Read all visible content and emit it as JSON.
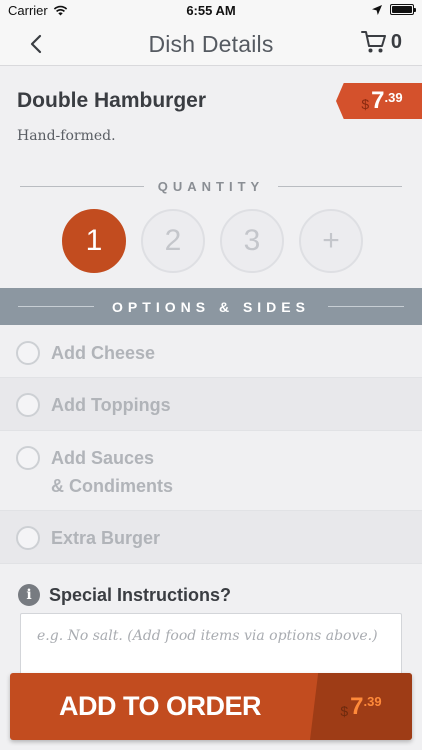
{
  "status_bar": {
    "carrier": "Carrier",
    "time": "6:55 AM",
    "icons": [
      "wifi-icon",
      "location-arrow-icon",
      "battery-icon"
    ]
  },
  "nav": {
    "title": "Dish Details",
    "cart_count": "0",
    "icons": [
      "chevron-left-icon",
      "cart-icon"
    ]
  },
  "dish": {
    "name": "Double Hamburger",
    "description": "Hand-formed.",
    "price": {
      "currency": "$",
      "whole": "7",
      "cents": ".39"
    }
  },
  "quantity": {
    "label": "QUANTITY",
    "options": [
      "1",
      "2",
      "3",
      "+"
    ],
    "selected": "1"
  },
  "options_section": {
    "label": "OPTIONS & SIDES",
    "items": [
      {
        "label": "Add Cheese",
        "label2": ""
      },
      {
        "label": "Add Toppings",
        "label2": ""
      },
      {
        "label": "Add Sauces",
        "label2": "& Condiments"
      },
      {
        "label": "Extra Burger",
        "label2": ""
      }
    ]
  },
  "instructions": {
    "title": "Special Instructions?",
    "placeholder": "e.g. No salt. (Add food items via options above.)"
  },
  "add_button": {
    "label": "ADD TO ORDER",
    "price": {
      "currency": "$",
      "whole": "7",
      "cents": ".39"
    }
  },
  "colors": {
    "accent": "#c24c1f",
    "price_tag": "#d4512c",
    "section_bar": "#8c97a1"
  }
}
